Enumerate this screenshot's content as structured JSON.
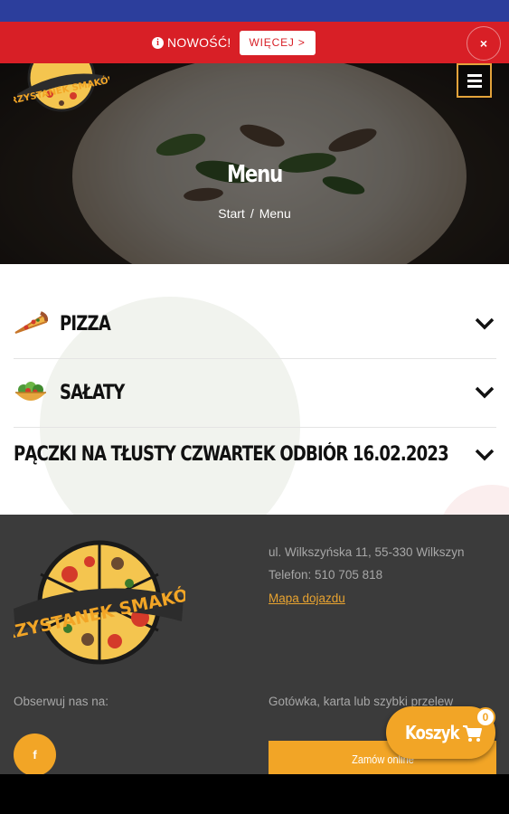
{
  "promo": {
    "info_icon": "info-icon",
    "label": "NOWOŚĆ!",
    "button_label": "WIĘCEJ >",
    "close_label": "×"
  },
  "header": {
    "title": "Menu",
    "breadcrumb": {
      "home": "Start",
      "separator": "/",
      "current": "Menu"
    },
    "logo_text": "PRZYSTANEK SMAKÓW",
    "menu_icon": "hamburger-icon"
  },
  "categories": [
    {
      "label": "PIZZA",
      "icon": "pizza-slice-icon"
    },
    {
      "label": "SAŁATY",
      "icon": "salad-bowl-icon"
    },
    {
      "label": "PĄCZKI NA TŁUSTY CZWARTEK ODBIÓR 16.02.2023",
      "icon": ""
    }
  ],
  "footer": {
    "logo_text": "PRZYSTANEK SMAKÓW",
    "address": "ul. Wilkszyńska 11, 55-330 Wilkszyn",
    "phone": "Telefon: 510 705 818",
    "map_link": "Mapa dojazdu",
    "follow_label": "Obserwuj nas na:",
    "facebook_label": "f",
    "payment_text": "Gotówka, karta lub szybki przelew",
    "order_button": "Zamów online"
  },
  "cart": {
    "label": "Koszyk",
    "count": "0"
  },
  "colors": {
    "accent": "#f2a526",
    "promo_red": "#d81f26",
    "footer_bg": "#3b3b3b",
    "status_blue": "#2c3e9c"
  }
}
